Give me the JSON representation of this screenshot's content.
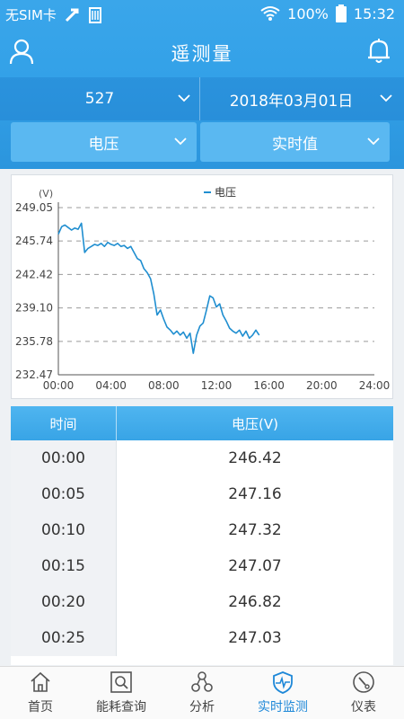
{
  "status_bar": {
    "carrier": "无SIM卡",
    "battery": "100%",
    "time": "15:32"
  },
  "header": {
    "title": "遥测量"
  },
  "filters": {
    "device": "527",
    "date": "2018年03月01日",
    "metric": "电压",
    "value_type": "实时值"
  },
  "colors": {
    "header": "#33a1e8",
    "accent": "#1e88d8",
    "line": "#1f8ed0"
  },
  "chart_data": {
    "type": "line",
    "legend": "电压",
    "ylabel": "(V)",
    "yticks": [
      249.05,
      245.74,
      242.42,
      239.1,
      235.78,
      232.47
    ],
    "xticks": [
      "00:00",
      "04:00",
      "08:00",
      "12:00",
      "16:00",
      "20:00",
      "24:00"
    ],
    "ylim": [
      232.47,
      249.05
    ],
    "xlim": [
      0,
      24
    ],
    "grid": "dashed-horizontal",
    "series": [
      {
        "name": "电压",
        "x": [
          0,
          0.25,
          0.5,
          0.75,
          1,
          1.25,
          1.5,
          1.75,
          2,
          2.25,
          2.5,
          2.75,
          3,
          3.25,
          3.5,
          3.75,
          4,
          4.25,
          4.5,
          4.75,
          5,
          5.25,
          5.5,
          5.75,
          6,
          6.25,
          6.5,
          6.75,
          7,
          7.25,
          7.5,
          7.75,
          8,
          8.25,
          8.5,
          8.75,
          9,
          9.25,
          9.5,
          9.75,
          10,
          10.25,
          10.5,
          10.75,
          11,
          11.25,
          11.5,
          11.75,
          12,
          12.25,
          12.5,
          12.75,
          13,
          13.25,
          13.5,
          13.75,
          14,
          14.25,
          14.5,
          14.75,
          15,
          15.25
        ],
        "y": [
          246.42,
          247.16,
          247.32,
          247.07,
          246.82,
          247.03,
          246.9,
          247.5,
          244.6,
          245.0,
          245.2,
          245.4,
          245.3,
          245.5,
          245.2,
          245.6,
          245.4,
          245.3,
          245.5,
          245.2,
          245.3,
          245.0,
          245.2,
          244.6,
          244.0,
          243.8,
          243.0,
          242.6,
          242.0,
          240.5,
          238.4,
          238.9,
          238.0,
          237.2,
          236.9,
          236.5,
          236.8,
          236.4,
          236.7,
          236.1,
          236.6,
          234.6,
          236.4,
          237.3,
          237.6,
          238.9,
          240.3,
          240.1,
          239.2,
          239.5,
          238.4,
          237.8,
          237.1,
          236.8,
          236.6,
          236.9,
          236.3,
          236.8,
          236.1,
          236.4,
          236.9,
          236.4
        ]
      }
    ]
  },
  "table": {
    "headers": [
      "时间",
      "电压(V)"
    ],
    "rows": [
      {
        "time": "00:00",
        "value": "246.42"
      },
      {
        "time": "00:05",
        "value": "247.16"
      },
      {
        "time": "00:10",
        "value": "247.32"
      },
      {
        "time": "00:15",
        "value": "247.07"
      },
      {
        "time": "00:20",
        "value": "246.82"
      },
      {
        "time": "00:25",
        "value": "247.03"
      }
    ]
  },
  "bottom_nav": [
    {
      "label": "首页",
      "icon": "home-icon"
    },
    {
      "label": "能耗查询",
      "icon": "energy-search-icon"
    },
    {
      "label": "分析",
      "icon": "analysis-icon"
    },
    {
      "label": "实时监测",
      "icon": "monitor-icon",
      "active": true
    },
    {
      "label": "仪表",
      "icon": "gauge-icon"
    }
  ]
}
